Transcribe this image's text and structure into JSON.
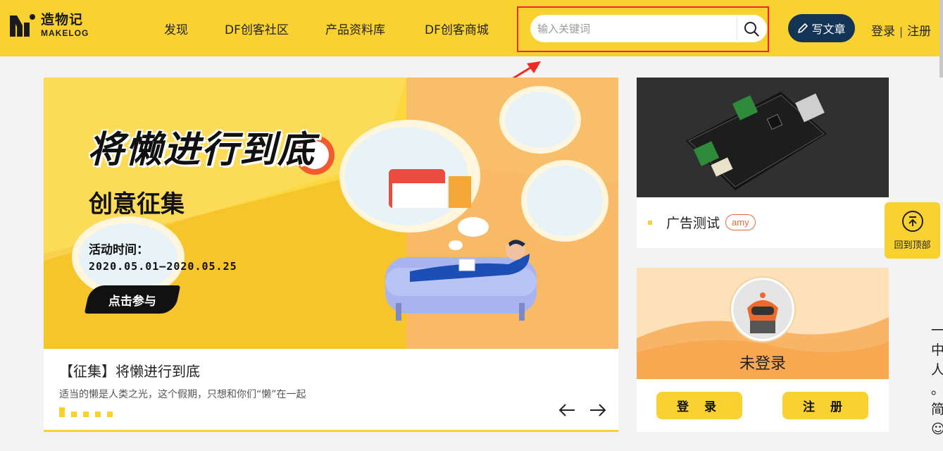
{
  "header": {
    "logo_cn": "造物记",
    "logo_en": "MAKELOG",
    "nav": [
      "发现",
      "DF创客社区",
      "产品资料库",
      "DF创客商城"
    ],
    "search_placeholder": "输入关键词",
    "write_label": "写文章",
    "login": "登录",
    "register": "注册"
  },
  "banner": {
    "title": "将懒进行到底",
    "subtitle": "创意征集",
    "time_label": "活动时间：",
    "time_range": "2020.05.01—2020.05.25",
    "join_label": "点击参与",
    "caption_title": "【征集】将懒进行到底",
    "caption_desc": "适当的懒是人类之光，这个假期，只想和你们“懒”在一起",
    "slide_count": 5,
    "active_slide": 1
  },
  "ad": {
    "title": "广告测试",
    "tag": "amy"
  },
  "login_card": {
    "status": "未登录",
    "login_button": "登 录",
    "register_button": "注 册"
  },
  "back_to_top": "回到顶部",
  "edge_text": [
    "一",
    "中",
    "人",
    "。",
    "简",
    "☺"
  ],
  "colors": {
    "brand_yellow": "#f9d231",
    "navy": "#143456",
    "highlight_red": "#ee2a24",
    "tag_orange": "#e86a3c"
  }
}
